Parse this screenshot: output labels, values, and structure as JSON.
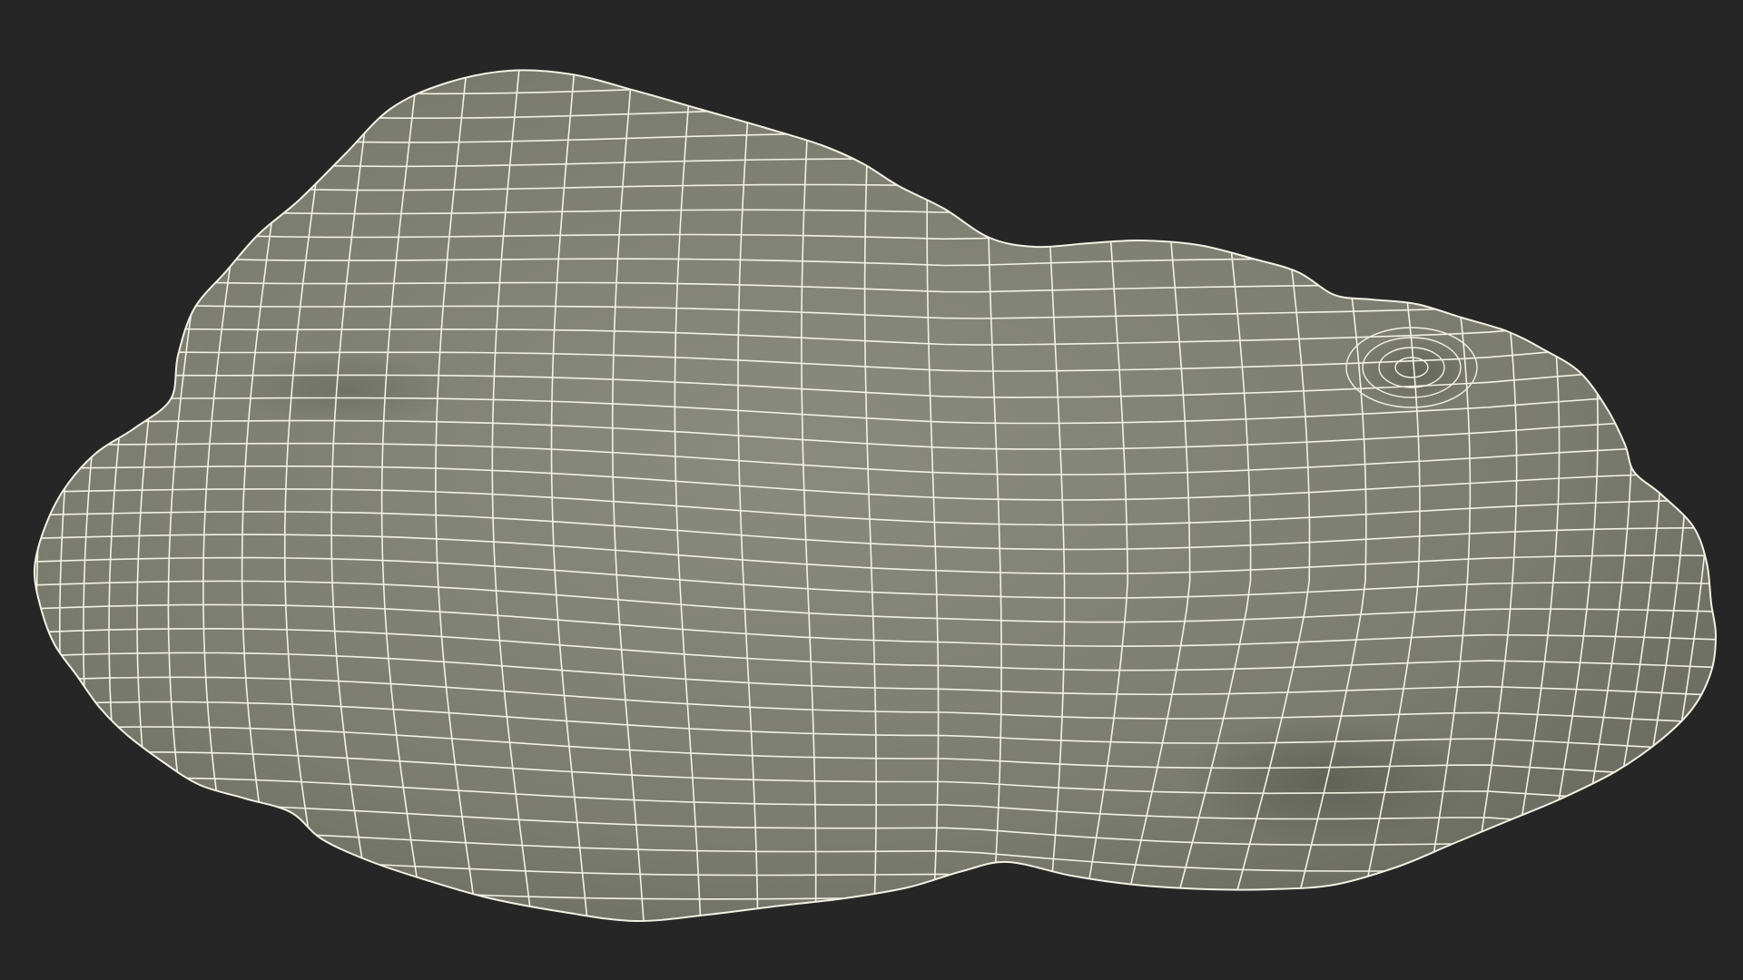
{
  "viewport": {
    "background_color": "#262626"
  },
  "model": {
    "subject": "organic-blob-wireframe-mesh",
    "surface_color": "#7b7c70",
    "surface_highlight_color": "#8a8b7f",
    "surface_shadow_color": "#5f6057",
    "wire_color": "#f2f1e3"
  }
}
